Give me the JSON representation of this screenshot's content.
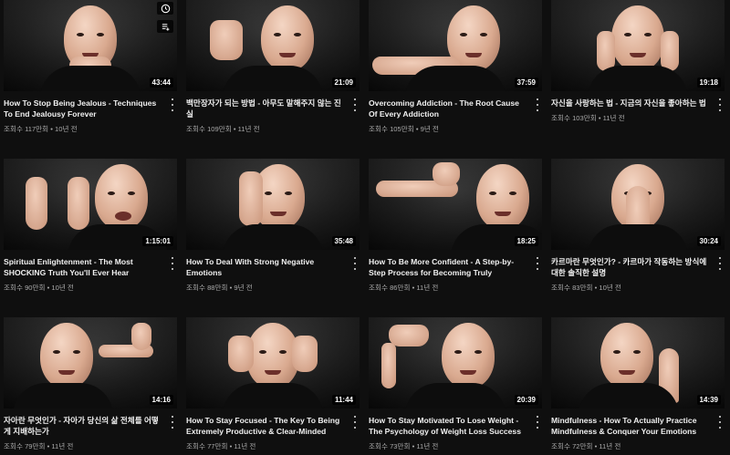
{
  "videos": [
    {
      "title": "How To Stop Being Jealous - Techniques To End Jealousy Forever",
      "duration": "43:44",
      "views": "조회수 117만회",
      "age": "10년 전"
    },
    {
      "title": "백만장자가 되는 방법 - 아무도 말해주지 않는 진실",
      "duration": "21:09",
      "views": "조회수 109만회",
      "age": "11년 전"
    },
    {
      "title": "Overcoming Addiction - The Root Cause Of Every Addiction",
      "duration": "37:59",
      "views": "조회수 105만회",
      "age": "9년 전"
    },
    {
      "title": "자신을 사랑하는 법 - 지금의 자신을 좋아하는 법",
      "duration": "19:18",
      "views": "조회수 103만회",
      "age": "11년 전"
    },
    {
      "title": "Spiritual Enlightenment - The Most SHOCKING Truth You'll Ever Hear",
      "duration": "1:15:01",
      "views": "조회수 90만회",
      "age": "10년 전"
    },
    {
      "title": "How To Deal With Strong Negative Emotions",
      "duration": "35:48",
      "views": "조회수 88만회",
      "age": "9년 전"
    },
    {
      "title": "How To Be More Confident - A Step-by-Step Process for Becoming Truly Confident",
      "duration": "18:25",
      "views": "조회수 86만회",
      "age": "11년 전"
    },
    {
      "title": "카르마란 무엇인가? - 카르마가 작동하는 방식에 대한 솔직한 설명",
      "duration": "30:24",
      "views": "조회수 83만회",
      "age": "10년 전"
    },
    {
      "title": "자아란 무엇인가 - 자아가 당신의 삶 전체를 어떻게 지배하는가",
      "duration": "14:16",
      "views": "조회수 79만회",
      "age": "11년 전"
    },
    {
      "title": "How To Stay Focused - The Key To Being Extremely Productive & Clear-Minded",
      "duration": "11:44",
      "views": "조회수 77만회",
      "age": "11년 전"
    },
    {
      "title": "How To Stay Motivated To Lose Weight - The Psychology of Weight Loss Success",
      "duration": "20:39",
      "views": "조회수 73만회",
      "age": "11년 전"
    },
    {
      "title": "Mindfulness - How To Actually Practice Mindfulness & Conquer Your Emotions",
      "duration": "14:39",
      "views": "조회수 72만회",
      "age": "11년 전"
    }
  ],
  "meta_separator": " • ",
  "hover_icons": [
    "clock-icon",
    "add-to-queue-icon"
  ],
  "colors": {
    "background": "#0f0f0f",
    "title": "#f1f1f1",
    "meta": "#aaaaaa"
  }
}
